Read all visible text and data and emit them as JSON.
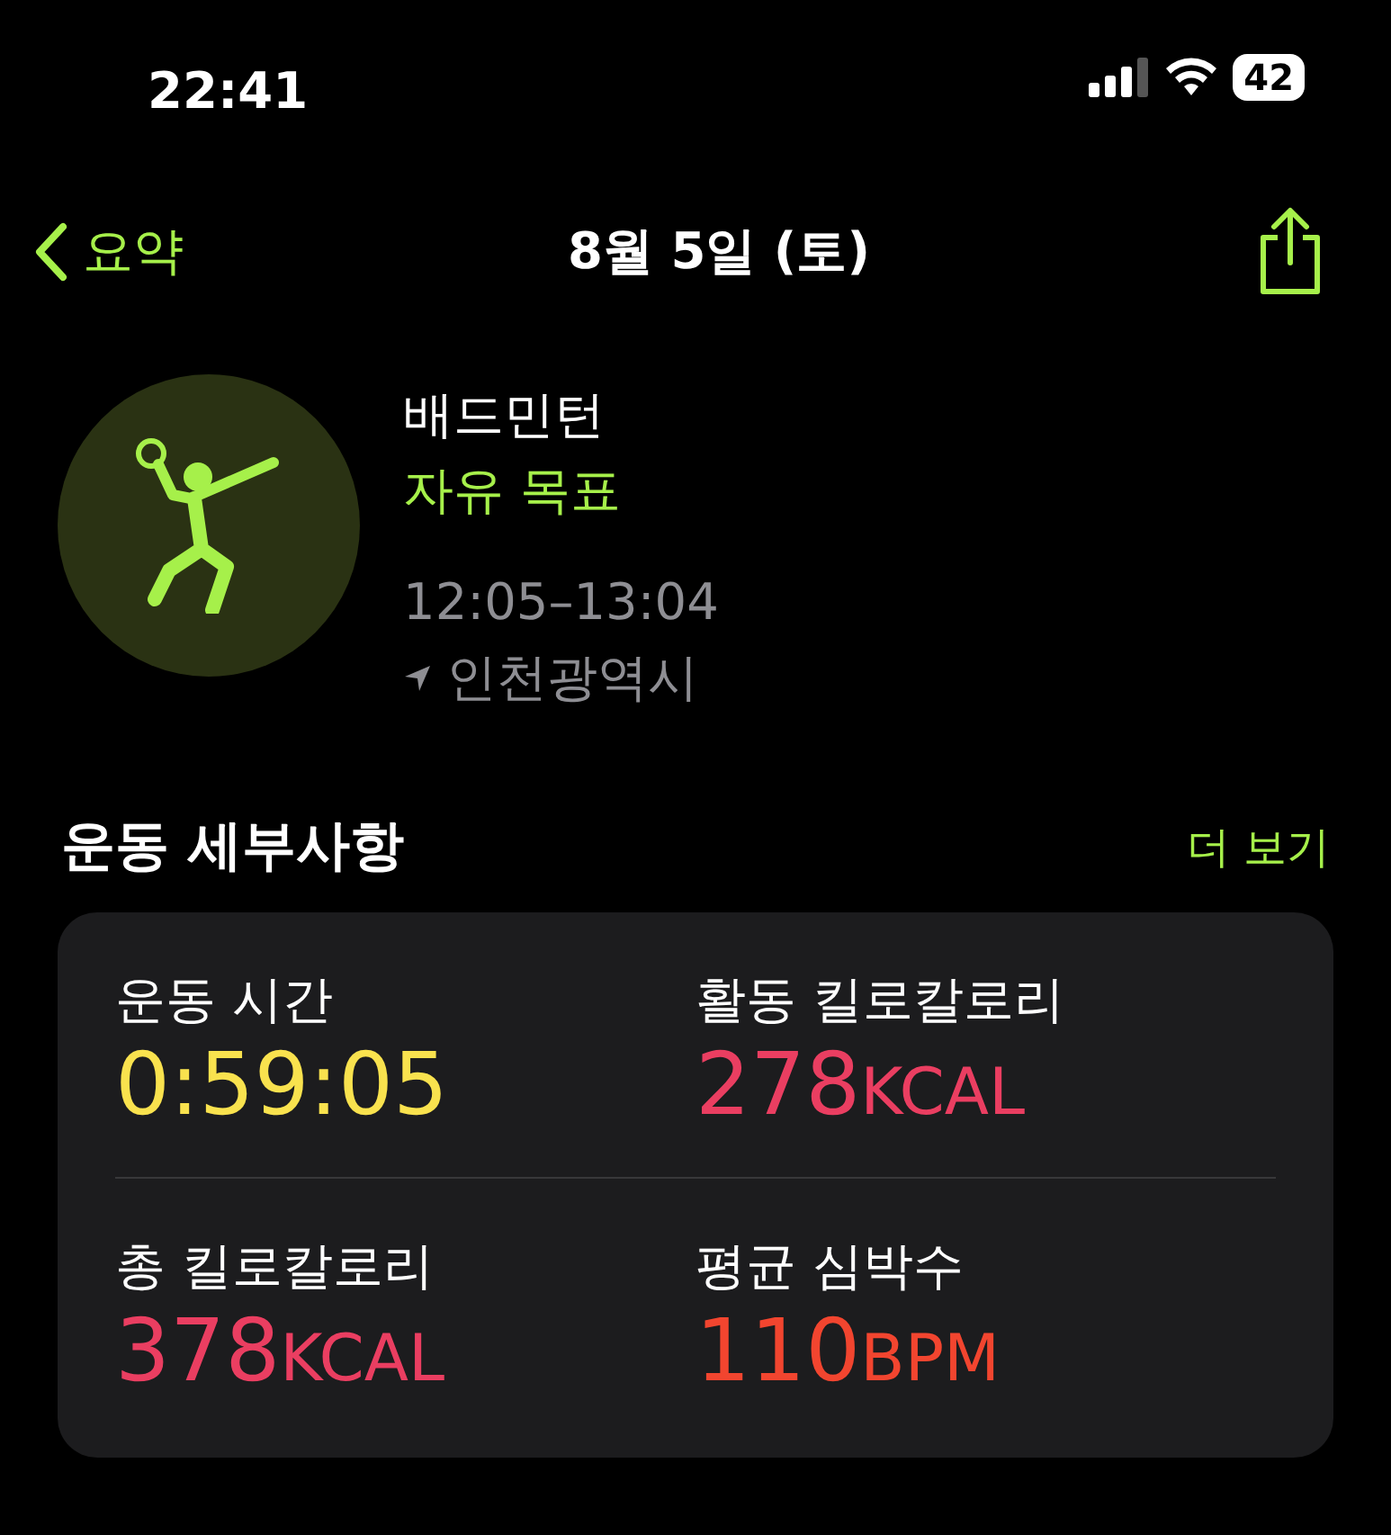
{
  "status_bar": {
    "time": "22:41",
    "battery": "42"
  },
  "nav": {
    "back": "요약",
    "title": "8월 5일 (토)"
  },
  "workout": {
    "name": "배드민턴",
    "goal": "자유 목표",
    "time_range": "12:05–13:04",
    "location": "인천광역시"
  },
  "section": {
    "title": "운동 세부사항",
    "more": "더 보기"
  },
  "metrics": [
    {
      "label": "운동 시간",
      "value": "0:59:05",
      "color": "#f9e24e"
    },
    {
      "label": "활동 킬로칼로리",
      "value": "278",
      "unit": "KCAL",
      "color": "#ea3e61"
    },
    {
      "label": "총 킬로칼로리",
      "value": "378",
      "unit": "KCAL",
      "color": "#ea3e61"
    },
    {
      "label": "평균 심박수",
      "value": "110",
      "unit": "BPM",
      "color": "#f2452f"
    }
  ]
}
